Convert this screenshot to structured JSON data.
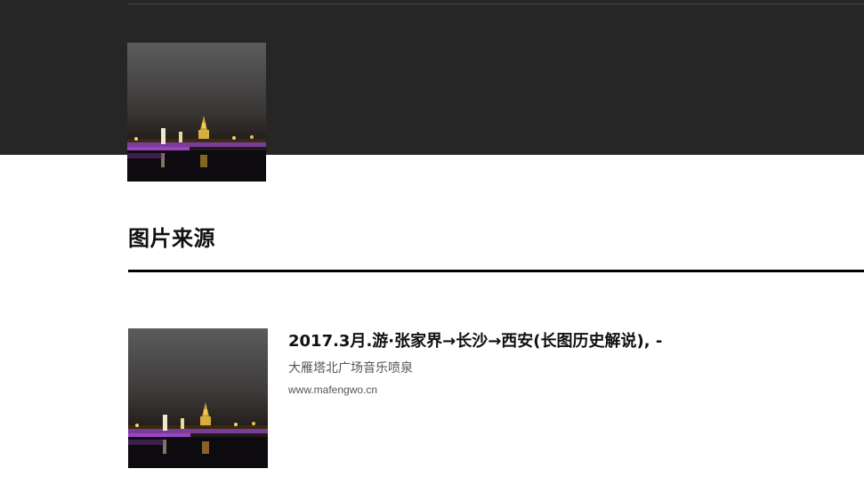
{
  "section": {
    "title": "图片来源"
  },
  "source": {
    "title": "2017.3月.游·张家界→长沙→西安(长图历史解说), -",
    "description": "大雁塔北广场音乐喷泉",
    "url": "www.mafengwo.cn"
  }
}
